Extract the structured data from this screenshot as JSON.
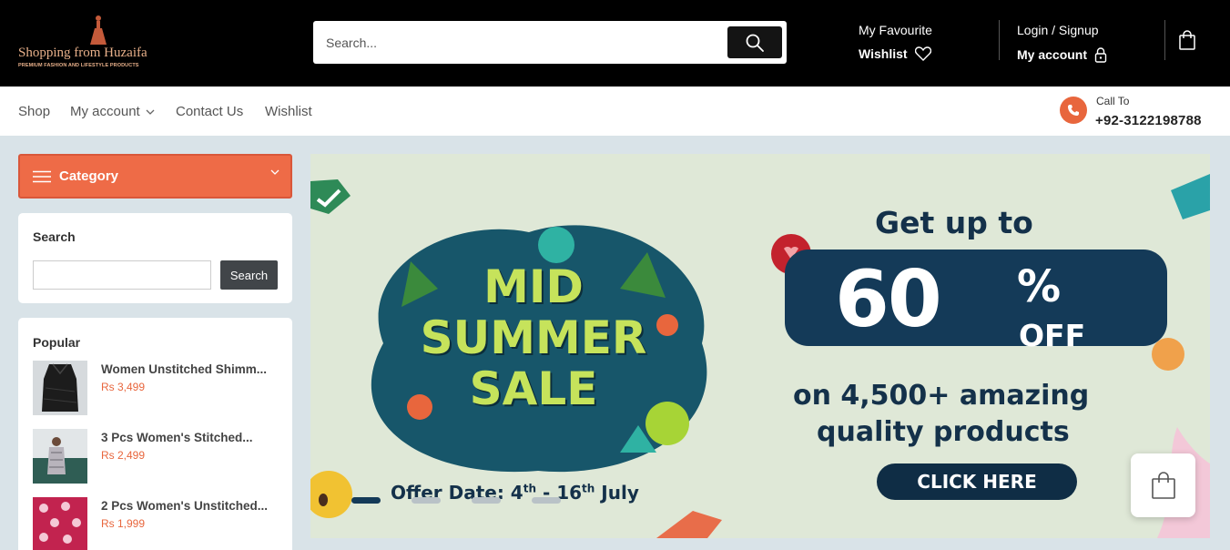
{
  "brand": {
    "name": "Shopping from Huzaifa",
    "tagline": "PREMIUM FASHION AND LIFESTYLE PRODUCTS"
  },
  "header": {
    "search_placeholder": "Search...",
    "favourite_label": "My Favourite",
    "wishlist_label": "Wishlist",
    "login_label": "Login / Signup",
    "account_label": "My account"
  },
  "nav": {
    "items": [
      "Shop",
      "My account",
      "Contact Us",
      "Wishlist"
    ],
    "call_label": "Call To",
    "phone": "+92-3122198788"
  },
  "sidebar": {
    "category_label": "Category",
    "search_title": "Search",
    "search_button": "Search",
    "popular_title": "Popular",
    "popular": [
      {
        "name": "Women Unstitched Shimm...",
        "price": "Rs 3,499"
      },
      {
        "name": "3 Pcs Women's Stitched...",
        "price": "Rs 2,499"
      },
      {
        "name": "2 Pcs Women's Unstitched...",
        "price": "Rs 1,999"
      }
    ]
  },
  "banner": {
    "art_line1": "MID",
    "art_line2": "SUMMER",
    "art_line3": "SALE",
    "headline": "Get up to",
    "percent": "60",
    "percent_sign": "%",
    "off": "OFF",
    "line1": "on 4,500+ amazing",
    "line2": "quality products",
    "cta": "CLICK HERE",
    "offer_prefix": "Offer Date: 4",
    "offer_sup1": "th",
    "offer_mid": " - 16",
    "offer_sup2": "th",
    "offer_suffix": " July",
    "active_slide": 1,
    "slide_count": 4
  },
  "colors": {
    "accent": "#ee6b47",
    "header_bg": "#000000",
    "page_bg": "#d9e3e8",
    "banner_navy": "#143a58"
  }
}
